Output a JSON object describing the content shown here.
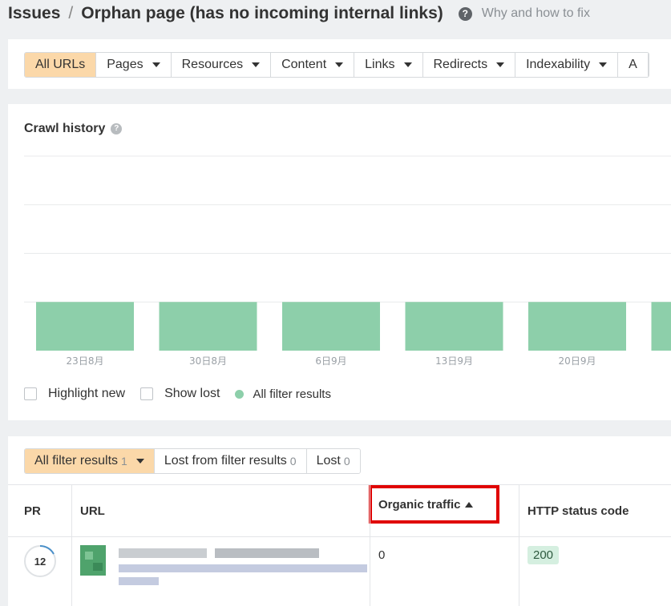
{
  "header": {
    "breadcrumb_root": "Issues",
    "separator": "/",
    "title": "Orphan page (has no incoming internal links)",
    "help_icon": "question-circle-icon",
    "why_link": "Why and how to fix"
  },
  "tabs": [
    {
      "label": "All URLs",
      "active": true,
      "dropdown": false
    },
    {
      "label": "Pages",
      "active": false,
      "dropdown": true
    },
    {
      "label": "Resources",
      "active": false,
      "dropdown": true
    },
    {
      "label": "Content",
      "active": false,
      "dropdown": true
    },
    {
      "label": "Links",
      "active": false,
      "dropdown": true
    },
    {
      "label": "Redirects",
      "active": false,
      "dropdown": true
    },
    {
      "label": "Indexability",
      "active": false,
      "dropdown": true
    },
    {
      "label": "A",
      "active": false,
      "dropdown": false
    }
  ],
  "crawl_history": {
    "title": "Crawl history",
    "legend": {
      "highlight_new": "Highlight new",
      "show_lost": "Show lost",
      "series_label": "All filter results"
    }
  },
  "chart_data": {
    "type": "bar",
    "categories": [
      "23日8月",
      "30日8月",
      "6日9月",
      "13日9月",
      "20日9月"
    ],
    "series": [
      {
        "name": "All filter results",
        "values": [
          1,
          1,
          1,
          1,
          1
        ],
        "color": "#8dcfaa"
      }
    ],
    "ylim": [
      0,
      4
    ],
    "grid": true,
    "legend_placement": "bottom-left"
  },
  "filter_tabs": [
    {
      "label": "All filter results",
      "count": "1",
      "active": true,
      "dropdown": true
    },
    {
      "label": "Lost from filter results",
      "count": "0",
      "active": false,
      "dropdown": false
    },
    {
      "label": "Lost",
      "count": "0",
      "active": false,
      "dropdown": false
    }
  ],
  "table": {
    "columns": {
      "pr": "PR",
      "url": "URL",
      "organic_traffic": "Organic traffic",
      "http_status": "HTTP status code"
    },
    "rows": [
      {
        "pr": "12",
        "organic_traffic": "0",
        "http_status": "200"
      }
    ]
  },
  "colors": {
    "active_tab": "#fbd8a9",
    "bar": "#8dcfaa",
    "highlight": "#e00000",
    "status_badge": "#d5efe0"
  }
}
